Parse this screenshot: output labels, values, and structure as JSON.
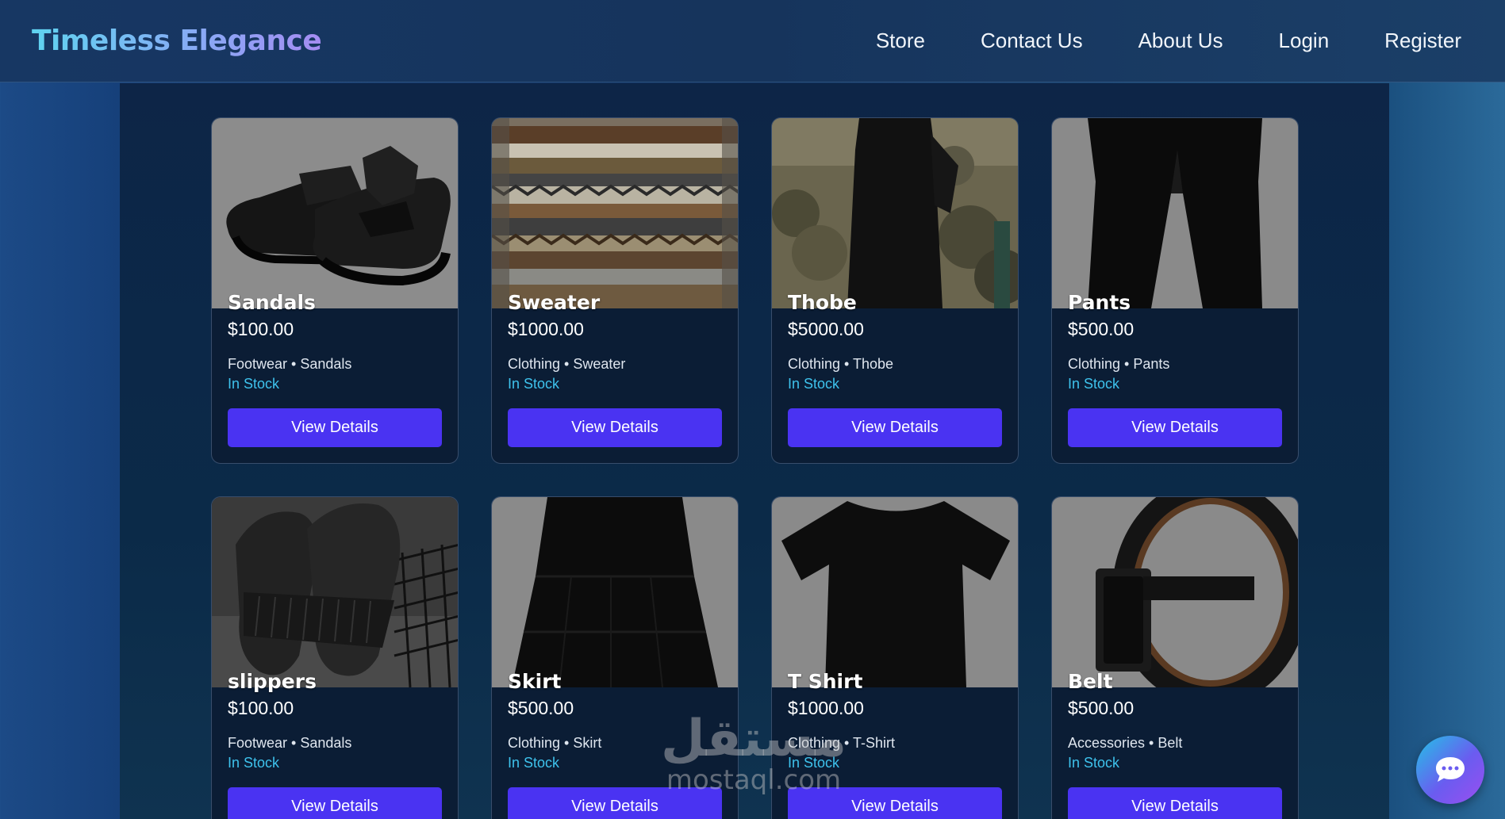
{
  "brand": "Timeless Elegance",
  "nav": [
    "Store",
    "Contact Us",
    "About Us",
    "Login",
    "Register"
  ],
  "products": [
    {
      "name": "Sandals",
      "price": "$100.00",
      "category": "Footwear • Sandals",
      "stock": "In Stock",
      "button": "View Details",
      "image": "sandals-image"
    },
    {
      "name": "Sweater",
      "price": "$1000.00",
      "category": "Clothing • Sweater",
      "stock": "In Stock",
      "button": "View Details",
      "image": "sweater-image"
    },
    {
      "name": "Thobe",
      "price": "$5000.00",
      "category": "Clothing • Thobe",
      "stock": "In Stock",
      "button": "View Details",
      "image": "thobe-image"
    },
    {
      "name": "Pants",
      "price": "$500.00",
      "category": "Clothing • Pants",
      "stock": "In Stock",
      "button": "View Details",
      "image": "pants-image"
    },
    {
      "name": "slippers",
      "price": "$100.00",
      "category": "Footwear • Sandals",
      "stock": "In Stock",
      "button": "View Details",
      "image": "slippers-image"
    },
    {
      "name": "Skirt",
      "price": "$500.00",
      "category": "Clothing • Skirt",
      "stock": "In Stock",
      "button": "View Details",
      "image": "skirt-image"
    },
    {
      "name": "T Shirt",
      "price": "$1000.00",
      "category": "Clothing • T-Shirt",
      "stock": "In Stock",
      "button": "View Details",
      "image": "tshirt-image"
    },
    {
      "name": "Belt",
      "price": "$500.00",
      "category": "Accessories • Belt",
      "stock": "In Stock",
      "button": "View Details",
      "image": "belt-image"
    }
  ],
  "watermark": {
    "arabic": "مستقل",
    "latin": "mostaql.com"
  },
  "chat_icon": "chat-bubble-icon",
  "colors": {
    "accent": "#4a33f2",
    "stock": "#3ec2ec"
  }
}
